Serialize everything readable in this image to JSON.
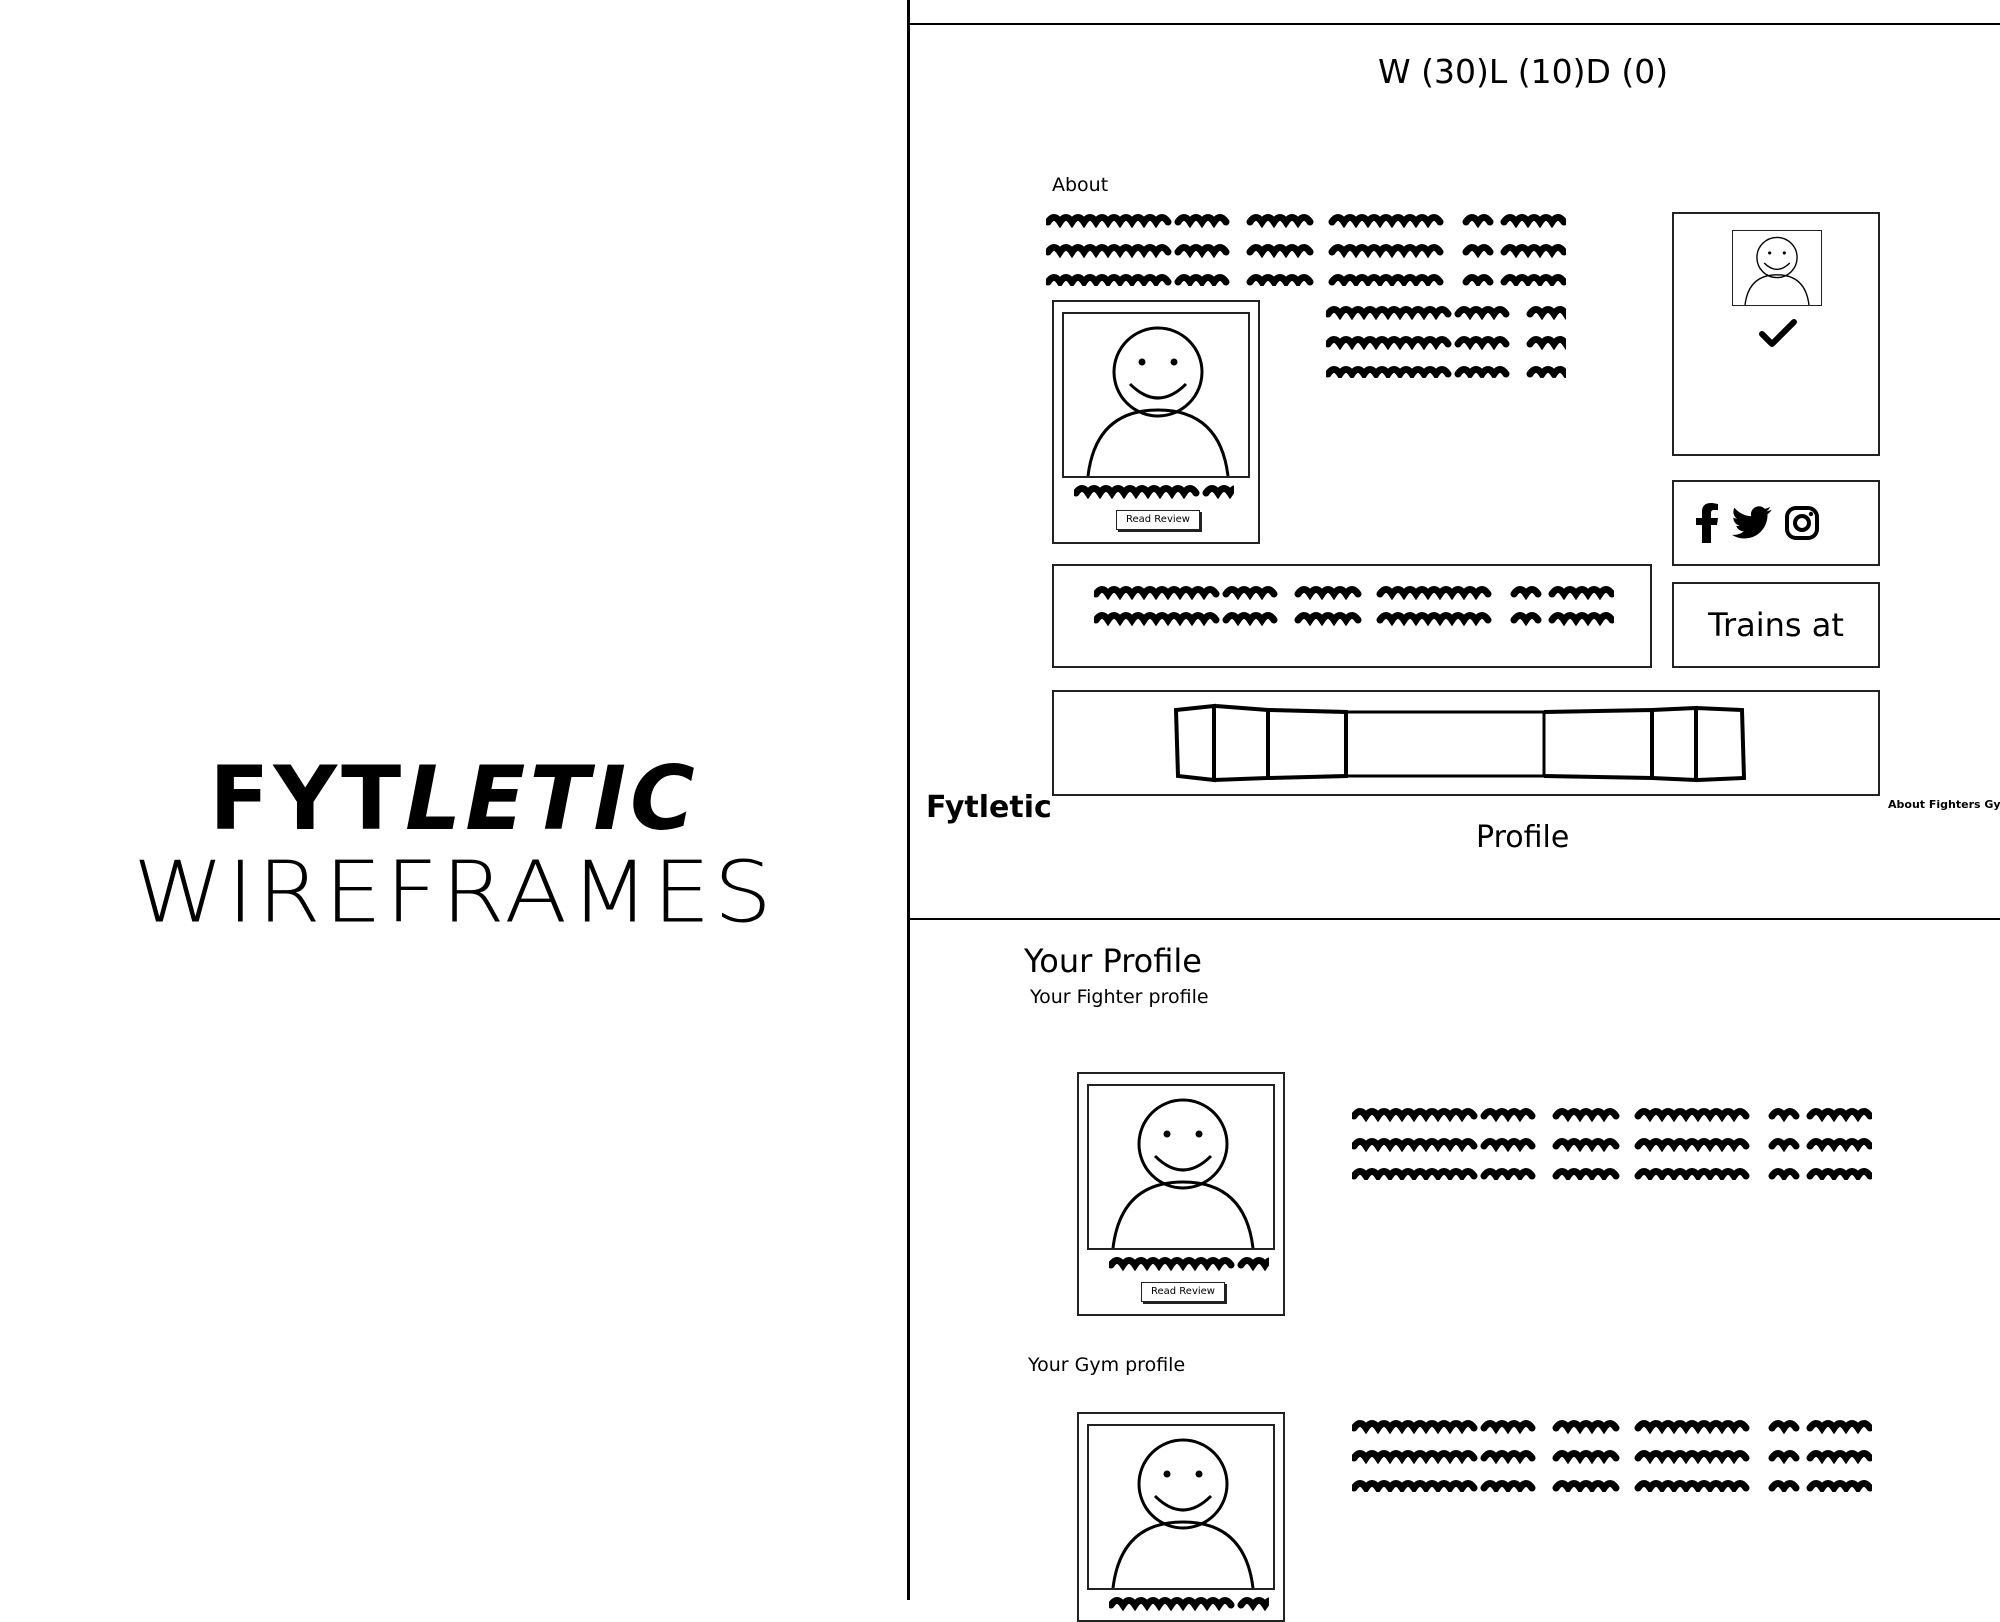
{
  "cover": {
    "brand_part1": "FYT",
    "brand_part2": "LETIC",
    "subtitle": "WIREFRAMES"
  },
  "profile_frame": {
    "record": "W (30)L (10)D (0)",
    "about_label": "About",
    "read_review": "Read Review",
    "trains_at": "Trains at",
    "social_icons": [
      "facebook-icon",
      "twitter-icon",
      "instagram-icon"
    ],
    "logo": "Fytletic",
    "nav_links": "About  Fighters Gym",
    "page_label": "Profile"
  },
  "your_profile_frame": {
    "heading": "Your Profile",
    "fighter_label": "Your Fighter profile",
    "gym_label": "Your Gym profile",
    "read_review": "Read Review"
  }
}
